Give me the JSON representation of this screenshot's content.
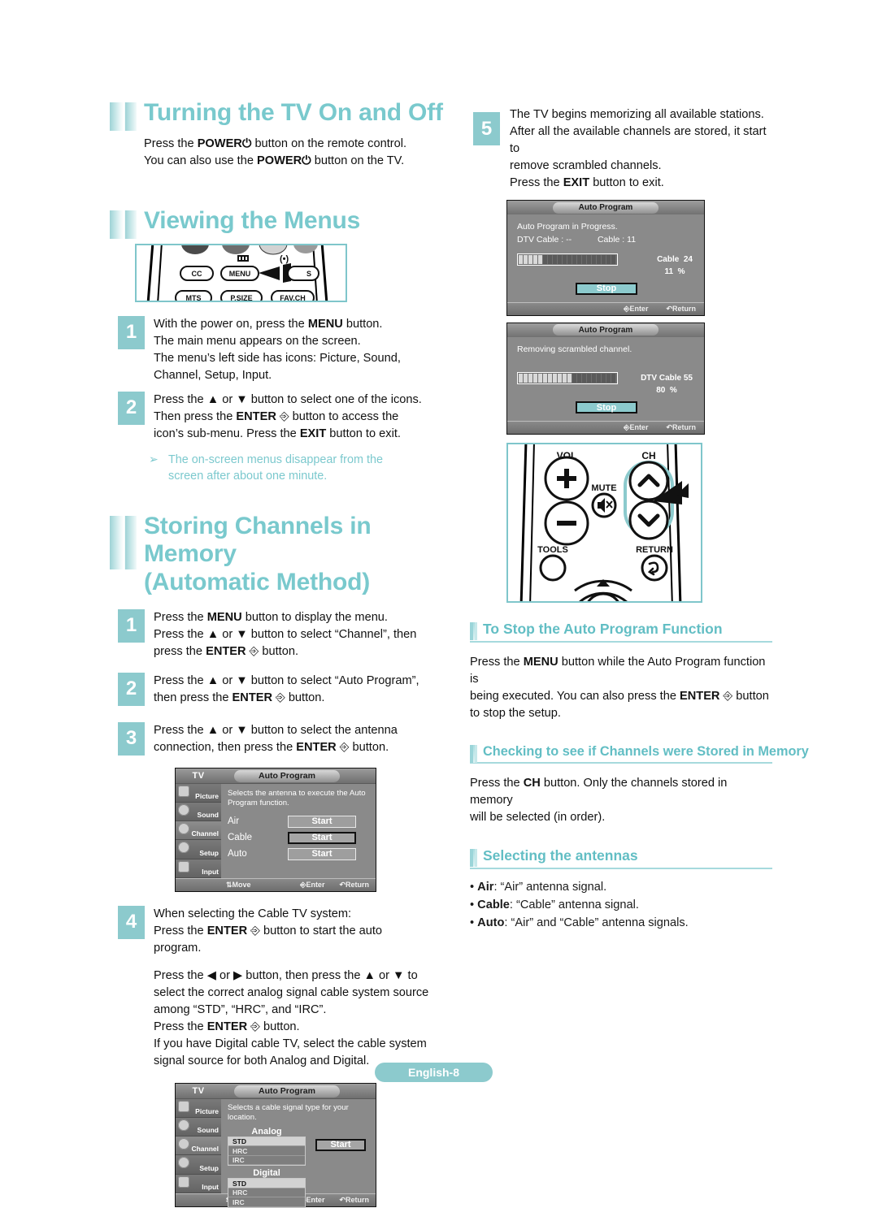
{
  "colors": {
    "accent": "#79c9cd",
    "step_badge": "#8ccacd",
    "note": "#7cc9ce",
    "rule": "#a6dadd"
  },
  "left": {
    "sections": [
      {
        "id": "turning-tv-on-off",
        "heading": "Turning the TV On and Off",
        "paragraph_line1": "Press the POWER",
        "paragraph": "Press the POWER⏻ button on the remote control.\nYou can also use the POWER⏻ button on the TV."
      },
      {
        "id": "viewing-the-menus",
        "heading": "Viewing the Menus"
      },
      {
        "id": "storing-channels",
        "heading_line1": "Storing Channels in Memory",
        "heading_line2": "(Automatic Method)"
      }
    ],
    "power_text_1": "Press the ",
    "power_bold_1": "POWER",
    "power_rest_1": " button on the remote control.",
    "power_text_2": "You can also use the ",
    "power_bold_2": "POWER",
    "power_rest_2": " button on the TV.",
    "remote_top_buttons": [
      "CC",
      "MENU",
      "S"
    ],
    "remote_bottom_buttons": [
      "MTS",
      "P.SIZE",
      "FAV.CH"
    ],
    "menu_steps": [
      {
        "num": "1",
        "lines": [
          "With the power on, press the MENU button.",
          "The main menu appears on the screen.",
          "The menu’s left side has icons: Picture, Sound,",
          "Channel, Setup, Input."
        ]
      },
      {
        "num": "2",
        "lines": [
          "Press the ▲ or ▼ button to select one of the icons.",
          "Then press the ENTER ↵ button to access the",
          "icon’s sub-menu. Press the EXIT button to exit."
        ]
      }
    ],
    "note": "The on-screen menus disappear from the\nscreen after about one minute.",
    "note_arrow": "➢",
    "store_steps": [
      {
        "num": "1",
        "lines": [
          "Press the MENU button to display the menu.",
          "Press the ▲ or ▼ button to select “Channel”, then",
          "press the ENTER ↵ button."
        ]
      },
      {
        "num": "2",
        "lines": [
          "Press the ▲ or ▼ button to select “Auto Program”,",
          "then press the ENTER ↵ button."
        ]
      },
      {
        "num": "3",
        "lines": [
          "Press the ▲ or ▼ button to select the antenna",
          "connection, then press the ENTER ↵ button."
        ]
      },
      {
        "num": "4",
        "lines": [
          "When selecting the Cable TV system:",
          "Press the ENTER ↵ button to start the auto",
          "program."
        ]
      }
    ],
    "step4_extra": [
      "Press the ◀ or ▶ button, then press the ▲ or ▼ to",
      "select the correct analog signal cable system source",
      "among “STD”, “HRC”, and “IRC”.",
      "Press the ENTER ↵ button.",
      "If you have Digital cable TV, select the cable system",
      "signal source for both Analog and Digital."
    ],
    "osd_antenna": {
      "tv_label": "TV",
      "title": "Auto Program",
      "sidebar": [
        "Picture",
        "Sound",
        "Channel",
        "Setup",
        "Input"
      ],
      "selected_sidebar": "Channel",
      "description": "Selects the antenna to execute the Auto Program function.",
      "rows": [
        {
          "label": "Air",
          "button": "Start",
          "highlighted": false
        },
        {
          "label": "Cable",
          "button": "Start",
          "highlighted": true
        },
        {
          "label": "Auto",
          "button": "Start",
          "highlighted": false
        }
      ],
      "footer": {
        "move": "Move",
        "enter": "Enter",
        "return": "Return"
      }
    },
    "osd_cable": {
      "tv_label": "TV",
      "title": "Auto Program",
      "sidebar": [
        "Picture",
        "Sound",
        "Channel",
        "Setup",
        "Input"
      ],
      "selected_sidebar": "Channel",
      "description": "Selects a cable signal type for your location.",
      "analog_label": "Analog",
      "digital_label": "Digital",
      "options": [
        "STD",
        "HRC",
        "IRC"
      ],
      "selected_option": "STD",
      "button": "Start",
      "footer": {
        "move": "Move",
        "enter": "Enter",
        "return": "Return"
      }
    }
  },
  "right": {
    "step5": {
      "num": "5",
      "lines": [
        "The TV begins memorizing all available stations.",
        "After all the available channels are stored, it start to",
        "remove scrambled channels.",
        "Press the EXIT button to exit."
      ]
    },
    "dialog_progress": {
      "title": "Auto Program",
      "line1": "Auto Program in Progress.",
      "line2_left": "DTV Cable : --",
      "line2_right": "Cable : 11",
      "stat_label": "Cable",
      "stat_value": "24",
      "percent_value": "11",
      "percent_unit": "%",
      "bar_filled_segments": 5,
      "bar_total_segments": 20,
      "stop": "Stop",
      "footer": {
        "enter": "Enter",
        "return": "Return"
      }
    },
    "dialog_removing": {
      "title": "Auto Program",
      "line1": "Removing scrambled channel.",
      "stat_label": "DTV Cable 55",
      "percent_value": "80",
      "percent_unit": "%",
      "bar_filled_segments": 11,
      "bar_total_segments": 20,
      "stop": "Stop",
      "footer": {
        "enter": "Enter",
        "return": "Return"
      }
    },
    "remote": {
      "vol_label": "VOL",
      "ch_label": "CH",
      "mute_label": "MUTE",
      "tools_label": "TOOLS",
      "return_label": "RETURN",
      "vol_up": "+",
      "vol_down": "−",
      "ch_up": "⌃",
      "ch_down": "⌄"
    },
    "subsections": [
      {
        "heading": "To Stop the Auto Program Function",
        "lines": [
          "Press the MENU button while the Auto Program function is",
          "being executed. You can also press the ENTER ↵ button",
          "to stop the setup."
        ]
      },
      {
        "heading": "Checking to see if Channels were Stored in Memory",
        "lines": [
          "Press the CH button. Only the channels stored in memory",
          "will be selected (in order)."
        ]
      },
      {
        "heading": "Selecting the antennas",
        "bullets": [
          {
            "term": "Air",
            "desc": ": “Air” antenna signal."
          },
          {
            "term": "Cable",
            "desc": ": “Cable” antenna signal."
          },
          {
            "term": "Auto",
            "desc": ": “Air” and “Cable” antenna signals."
          }
        ]
      }
    ]
  },
  "footer": {
    "page_label": "English-8"
  }
}
